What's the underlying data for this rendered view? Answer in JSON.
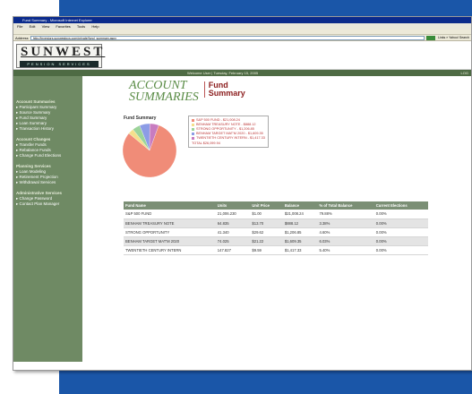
{
  "browser": {
    "title": "Fund Summary - Microsoft Internet Explorer",
    "menu": [
      "File",
      "Edit",
      "View",
      "Favorites",
      "Tools",
      "Help"
    ],
    "address_label": "Address",
    "url": "http://investors.sunwestpcs.com/private/fund_summary.aspx",
    "go_label": "Go",
    "links_label": "Links » Yahoo! Search"
  },
  "logo": {
    "top": "SUNWEST",
    "bottom": "PENSION SERVICES"
  },
  "welcome": {
    "text": "Welcome User  |  Tuesday, February 15, 2005",
    "right": "LOG"
  },
  "sidebar": [
    {
      "heading": "Account Summaries",
      "items": [
        "Participant Summary",
        "Source Summary",
        "Fund Summary",
        "Loan Summary",
        "Transaction History"
      ]
    },
    {
      "heading": "Account Changes",
      "items": [
        "Transfer Funds",
        "Rebalance Funds",
        "Change Fund Elections"
      ]
    },
    {
      "heading": "Planning Services",
      "items": [
        "Loan Modeling",
        "Retirement Projection",
        "Withdrawal Services"
      ]
    },
    {
      "heading": "Administrative Services",
      "items": [
        "Change Password",
        "Contact Plan Manager"
      ]
    }
  ],
  "page": {
    "section_line1": "ACCOUNT",
    "section_line2": "SUMMARIES",
    "title_line1": "Fund",
    "title_line2": "Summary"
  },
  "chart_data": {
    "type": "pie",
    "title": "Fund Summary",
    "slices": [
      {
        "label": "S&P 500 FUND - $21,008.24",
        "value": 21008.24,
        "color": "#f08c78"
      },
      {
        "label": "BENHAM TREASURY NOTE - $888.12",
        "value": 888.12,
        "color": "#f4e08c"
      },
      {
        "label": "STRONG OPPORTUNITY - $1,206.85",
        "value": 1206.85,
        "color": "#9cd49a"
      },
      {
        "label": "BENHAM TARGET MAT'M 2020 - $1,609.35",
        "value": 1609.35,
        "color": "#8c9ce6"
      },
      {
        "label": "TWENTIETH CENTURY INTERN - $1,417.33",
        "value": 1417.33,
        "color": "#c87cc0"
      }
    ],
    "total_label": "TOTAL $26,099.94"
  },
  "table": {
    "headers": [
      "Fund Name",
      "Units",
      "Unit Price",
      "Balance",
      "% of Total Balance",
      "Current Elections"
    ],
    "rows": [
      [
        "S&P 500 FUND",
        "21,006.230",
        "$1.00",
        "$21,008.24",
        "79.88%",
        "0.00%"
      ],
      [
        "BENHAM TREASURY NOTE",
        "64.835",
        "$13.70",
        "$888.12",
        "3.38%",
        "0.00%"
      ],
      [
        "STRONG OPPORTUNITY",
        "41.340",
        "$29.62",
        "$1,206.85",
        "4.60%",
        "0.00%"
      ],
      [
        "BENHAM TARGET MAT'M 2020",
        "74.025",
        "$21.22",
        "$1,609.35",
        "6.03%",
        "0.00%"
      ],
      [
        "TWENTIETH CENTURY INTERN",
        "147.827",
        "$9.59",
        "$1,417.33",
        "5.40%",
        "0.00%"
      ]
    ]
  }
}
